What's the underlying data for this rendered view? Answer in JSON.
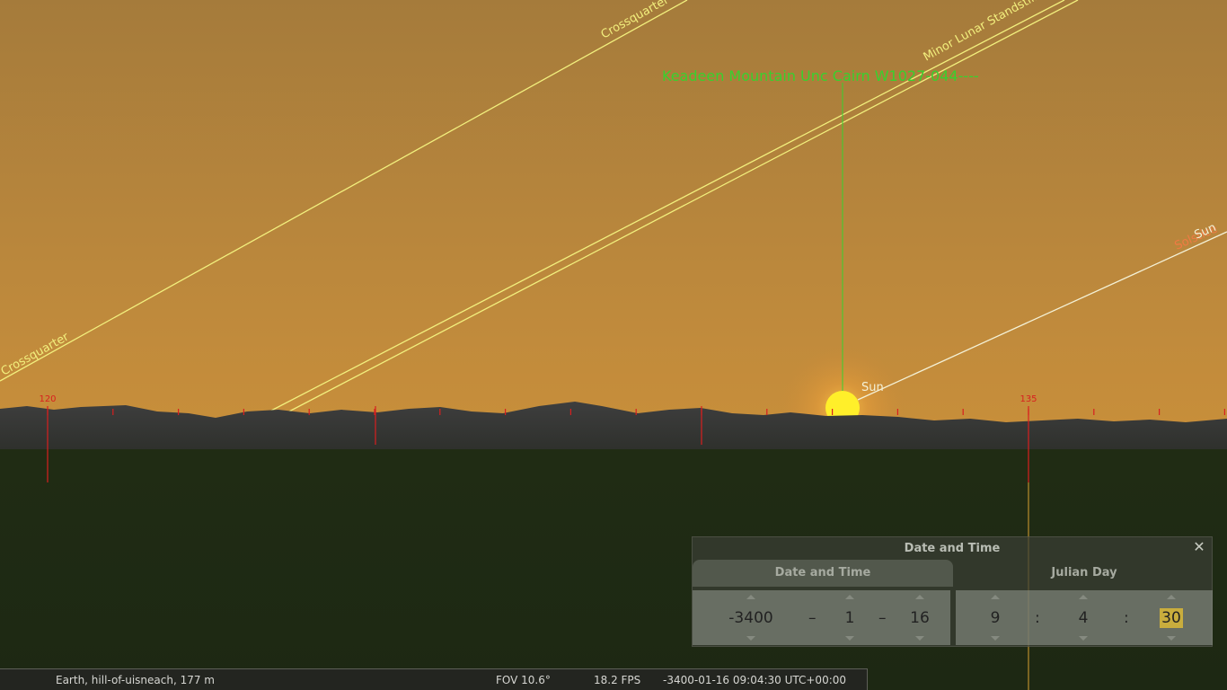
{
  "sky": {
    "target_label": "Keadeen Mountain Unc Cairn W1027-044----",
    "lines": {
      "crossquarter_top": "Crossquarter",
      "crossquarter_left": "Crossquarter",
      "minor_lunar": "Minor Lunar Standstill",
      "solstice": "Solstice",
      "sun_line_label": "Sun"
    },
    "sun_label": "Sun",
    "azimuth_labels": [
      "120",
      "135"
    ]
  },
  "colors": {
    "sky_top": "#a57b3b",
    "sky_horizon": "#c78e3b",
    "ground": "#1e2a13",
    "line_yellow": "#f2ef7d",
    "target_green": "#38d12e",
    "azimuth_red": "#d81f1f"
  },
  "dialog": {
    "title": "Date and Time",
    "close_icon": "close-icon",
    "tabs": [
      "Date and Time",
      "Julian Day"
    ],
    "date": {
      "year": "-3400",
      "month": "1",
      "day": "16",
      "separator": "–"
    },
    "time": {
      "hour": "9",
      "minute": "4",
      "second": "30",
      "separator": ":"
    }
  },
  "status": {
    "location": "Earth, hill-of-uisneach, 177 m",
    "fov": "FOV 10.6°",
    "fps": "18.2 FPS",
    "datetime": "-3400-01-16 09:04:30 UTC+00:00"
  }
}
